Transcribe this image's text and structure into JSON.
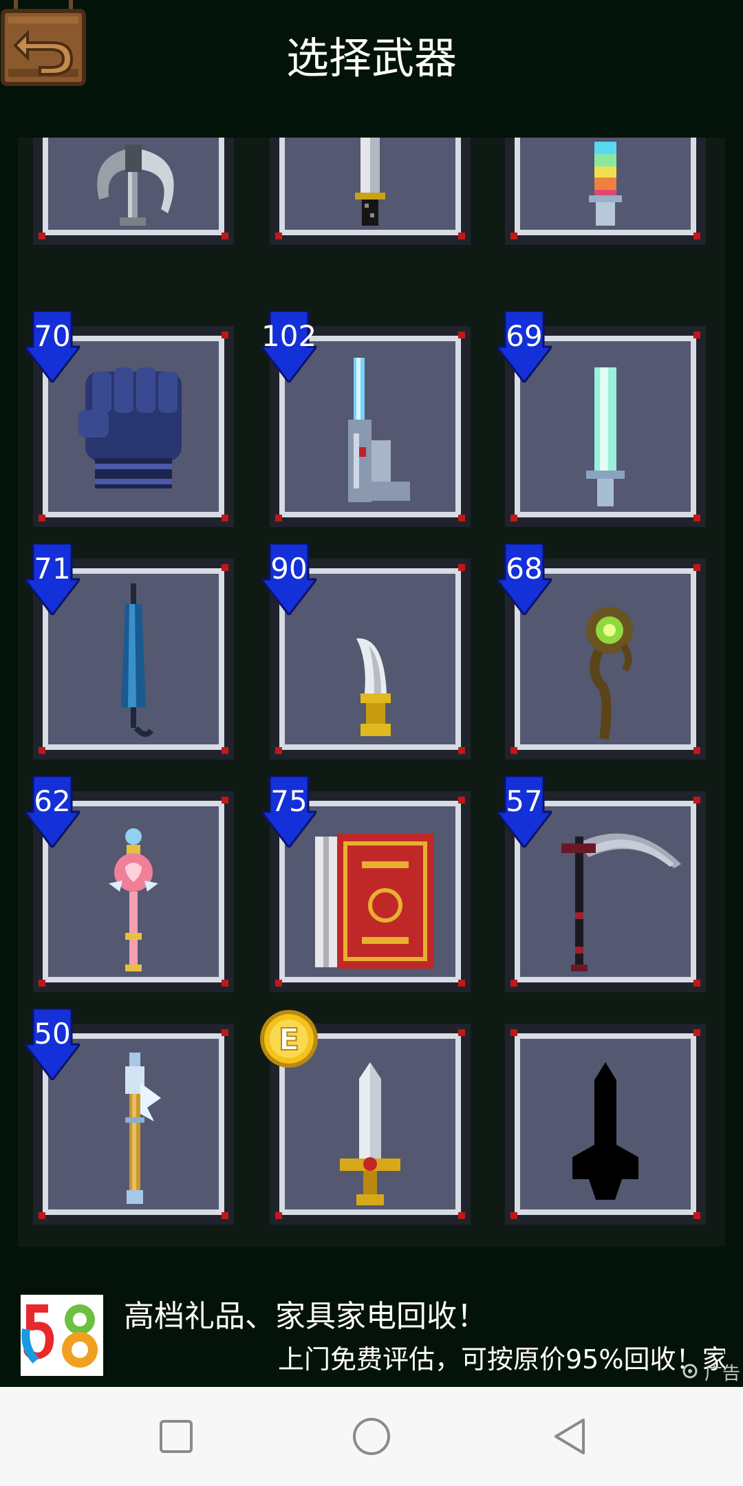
{
  "header": {
    "title": "选择武器",
    "back_icon": "back-arrow-icon"
  },
  "weapons": [
    {
      "name": "battle-axe",
      "badge": ""
    },
    {
      "name": "long-sword",
      "badge": ""
    },
    {
      "name": "rainbow-crystal-sword",
      "badge": ""
    },
    {
      "name": "gauntlet-fist",
      "badge": "70"
    },
    {
      "name": "laser-gun",
      "badge": "102"
    },
    {
      "name": "ice-crystal-sword",
      "badge": "69"
    },
    {
      "name": "blue-umbrella",
      "badge": "71"
    },
    {
      "name": "curved-dagger",
      "badge": "90"
    },
    {
      "name": "nature-staff",
      "badge": "68"
    },
    {
      "name": "pink-magic-wand",
      "badge": "62"
    },
    {
      "name": "red-spell-book",
      "badge": "75"
    },
    {
      "name": "dark-scythe",
      "badge": "57"
    },
    {
      "name": "frost-spear",
      "badge": "50"
    },
    {
      "name": "golden-sword",
      "badge": "",
      "coin_label": "E"
    },
    {
      "name": "locked-silhouette-weapon",
      "badge": ""
    }
  ],
  "ad": {
    "title": "高档礼品、家具家电回收！",
    "subtitle": "上门免费评估，可按原价95%回收！家",
    "mark": "广告",
    "logo_text": "58"
  },
  "nav": {
    "recent_icon": "square-icon",
    "home_icon": "circle-icon",
    "back_icon": "triangle-back-icon"
  },
  "colors": {
    "background": "#04130a",
    "cell_fill": "#545870",
    "frame_silver": "#d8dce4",
    "badge_blue": "#1430d8",
    "coin_gold": "#f4c21a"
  }
}
